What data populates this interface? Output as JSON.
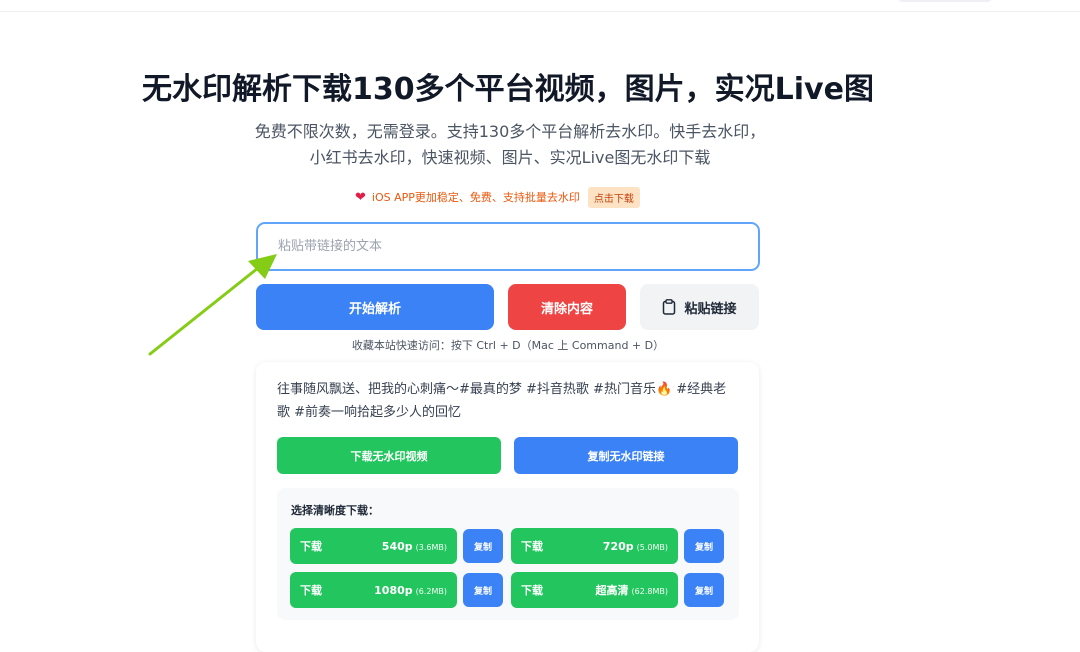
{
  "page": {
    "headline": "无水印解析下载130多个平台视频，图片，实况Live图",
    "subtitle": "免费不限次数，无需登录。支持130多个平台解析去水印。快手去水印，小红书去水印，快速视频、图片、实况Live图无水印下载"
  },
  "promo": {
    "heart_icon": "❤",
    "text": "iOS APP更加稳定、免费、支持批量去水印",
    "button_label": "点击下载",
    "color": "#ea580c"
  },
  "input": {
    "placeholder": "粘贴带链接的文本",
    "value": ""
  },
  "actions": {
    "parse_label": "开始解析",
    "clear_label": "清除内容",
    "paste_label": "粘贴链接",
    "paste_icon": "clipboard-icon"
  },
  "shortcut_hint": "收藏本站快速访问：按下 Ctrl + D（Mac 上 Command + D）",
  "result": {
    "title": "往事随风飘送、把我的心刺痛～#最真的梦 #抖音热歌 #热门音乐🔥 #经典老歌 #前奏一响拾起多少人的回忆",
    "download_video_label": "下载无水印视频",
    "copy_link_label": "复制无水印链接",
    "quality_title": "选择清晰度下载：",
    "qualities": [
      {
        "download": "下载",
        "quality": "540p",
        "size": "(3.6MB)",
        "copy": "复制"
      },
      {
        "download": "下载",
        "quality": "720p",
        "size": "(5.0MB)",
        "copy": "复制"
      },
      {
        "download": "下载",
        "quality": "1080p",
        "size": "(6.2MB)",
        "copy": "复制"
      },
      {
        "download": "下载",
        "quality": "超高清",
        "size": "(62.8MB)",
        "copy": "复制"
      }
    ]
  },
  "colors": {
    "primary": "#3b82f6",
    "danger": "#ef4444",
    "success": "#22c55e",
    "arrow": "#84cc16"
  }
}
